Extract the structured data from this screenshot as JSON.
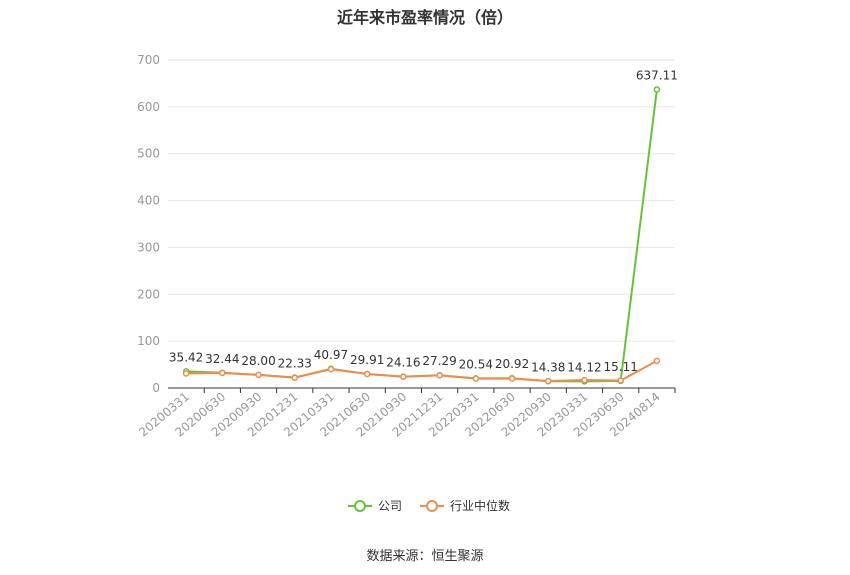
{
  "chart_data": {
    "type": "line",
    "title": "近年来市盈率情况（倍）",
    "source": "数据来源：恒生聚源",
    "categories": [
      "20200331",
      "20200630",
      "20200930",
      "20201231",
      "20210331",
      "20210630",
      "20210930",
      "20211231",
      "20220331",
      "20220630",
      "20220930",
      "20230331",
      "20230630",
      "20240814"
    ],
    "ylim": [
      0,
      700
    ],
    "yticks": [
      0,
      100,
      200,
      300,
      400,
      500,
      600,
      700
    ],
    "grid": true,
    "legend_position": "bottom",
    "series": [
      {
        "name": "公司",
        "color": "#67c23a",
        "values": [
          35.42,
          32.44,
          28.0,
          22.33,
          40.97,
          29.91,
          24.16,
          27.29,
          20.54,
          20.92,
          14.38,
          14.12,
          15.11,
          637.11
        ],
        "labels": [
          "35.42",
          "32.44",
          "28.00",
          "22.33",
          "40.97",
          "29.91",
          "24.16",
          "27.29",
          "20.54",
          "20.92",
          "14.38",
          "14.12",
          "15.11",
          "637.11"
        ]
      },
      {
        "name": "行业中位数",
        "color": "#f08c50",
        "values": [
          31,
          32,
          28,
          22,
          40,
          30,
          24,
          27,
          20,
          20,
          15,
          17,
          16,
          58
        ]
      }
    ]
  }
}
